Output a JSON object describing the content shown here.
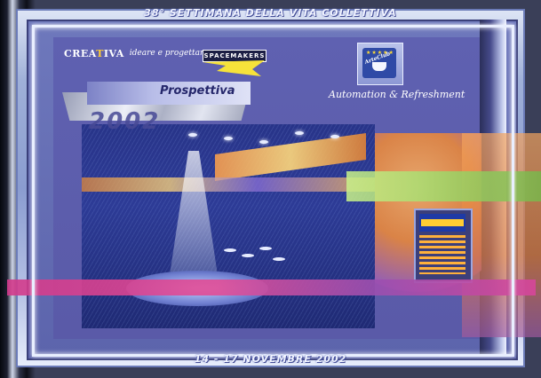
{
  "header": {
    "title": "38° SETTIMANA DELLA VITA COLLETTIVA"
  },
  "footer": {
    "dates": "14 - 17 NOVEMBRE 2002"
  },
  "logos": {
    "creativa": {
      "word_left": "CREA",
      "word_mid": "T",
      "word_right": "IVA",
      "tagline": "ideare e progettare"
    },
    "spacemakers": {
      "word": "SPACEMAKERS"
    },
    "vending": {
      "stars": "★★★★★",
      "word": "ArteClub"
    }
  },
  "main": {
    "heading": "Prospettiva",
    "year": "2002",
    "slogan": "Automation & Refreshment"
  },
  "colors": {
    "frame": "#9fb0d8",
    "panel": "#5c64ac",
    "pink_band": "#e14d97",
    "green_band": "#9fd86a",
    "accent_orange": "#f08a35"
  }
}
